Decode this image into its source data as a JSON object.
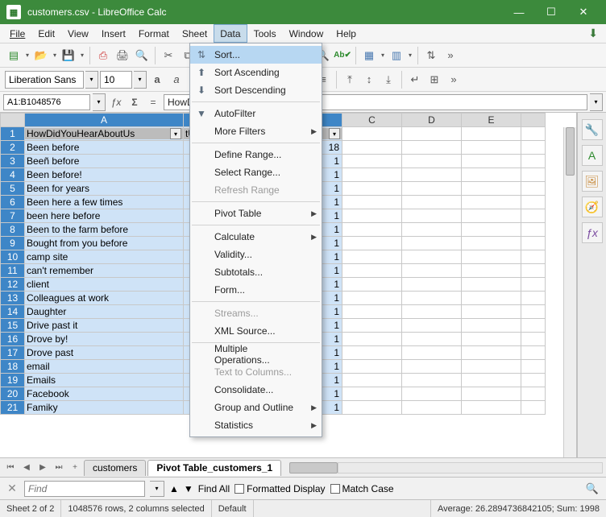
{
  "title": "customers.csv - LibreOffice Calc",
  "menu": {
    "file": "File",
    "edit": "Edit",
    "view": "View",
    "insert": "Insert",
    "format": "Format",
    "sheet": "Sheet",
    "data": "Data",
    "tools": "Tools",
    "window": "Window",
    "help": "Help"
  },
  "font": {
    "name": "Liberation Sans",
    "size": "10"
  },
  "namebox": "A1:B1048576",
  "formula": "HowDidYouHearAboutUs",
  "dataMenu": {
    "sort": "Sort...",
    "sortAsc": "Sort Ascending",
    "sortDesc": "Sort Descending",
    "autoFilter": "AutoFilter",
    "moreFilters": "More Filters",
    "defineRange": "Define Range...",
    "selectRange": "Select Range...",
    "refreshRange": "Refresh Range",
    "pivotTable": "Pivot Table",
    "calculate": "Calculate",
    "validity": "Validity...",
    "subtotals": "Subtotals...",
    "form": "Form...",
    "streams": "Streams...",
    "xmlSource": "XML Source...",
    "multipleOps": "Multiple Operations...",
    "textToColumns": "Text to Columns...",
    "consolidate": "Consolidate...",
    "groupOutline": "Group and Outline",
    "statistics": "Statistics"
  },
  "columns": {
    "A": "A",
    "B": "tUs",
    "C": "C",
    "D": "D",
    "E": "E"
  },
  "headers": {
    "A": "HowDidYouHearAboutUs",
    "B": "tUs"
  },
  "rows": [
    {
      "n": 2,
      "a": "Been before",
      "b": "18"
    },
    {
      "n": 3,
      "a": "Beeñ before",
      "b": "1"
    },
    {
      "n": 4,
      "a": "Been before!",
      "b": "1"
    },
    {
      "n": 5,
      "a": "Been for years",
      "b": "1"
    },
    {
      "n": 6,
      "a": "Been here a few times",
      "b": "1"
    },
    {
      "n": 7,
      "a": "been here before",
      "b": "1"
    },
    {
      "n": 8,
      "a": "Been to the farm before",
      "b": "1"
    },
    {
      "n": 9,
      "a": "Bought from you before",
      "b": "1"
    },
    {
      "n": 10,
      "a": "camp site",
      "b": "1"
    },
    {
      "n": 11,
      "a": "can't remember",
      "b": "1"
    },
    {
      "n": 12,
      "a": "client",
      "b": "1"
    },
    {
      "n": 13,
      "a": "Colleagues   at   work",
      "b": "1"
    },
    {
      "n": 14,
      "a": "Daughter",
      "b": "1"
    },
    {
      "n": 15,
      "a": "Drive past it",
      "b": "1"
    },
    {
      "n": 16,
      "a": "Drove by!",
      "b": "1"
    },
    {
      "n": 17,
      "a": "Drove past",
      "b": "1"
    },
    {
      "n": 18,
      "a": "email",
      "b": "1"
    },
    {
      "n": 19,
      "a": "Emails",
      "b": "1"
    },
    {
      "n": 20,
      "a": "Facebook",
      "b": "1"
    },
    {
      "n": 21,
      "a": "Famiky",
      "b": "1"
    }
  ],
  "sheetTabs": {
    "navFirst": "⏮",
    "navPrev": "◀",
    "navNext": "▶",
    "navLast": "⏭",
    "add": "+",
    "tab1": "customers",
    "tab2": "Pivot Table_customers_1"
  },
  "findBar": {
    "placeholder": "Find",
    "findAll": "Find All",
    "formatted": "Formatted Display",
    "matchCase": "Match Case"
  },
  "status": {
    "sheet": "Sheet 2 of 2",
    "sel": "1048576 rows, 2 columns selected",
    "style": "Default",
    "stats": "Average: 26.2894736842105; Sum: 1998"
  }
}
